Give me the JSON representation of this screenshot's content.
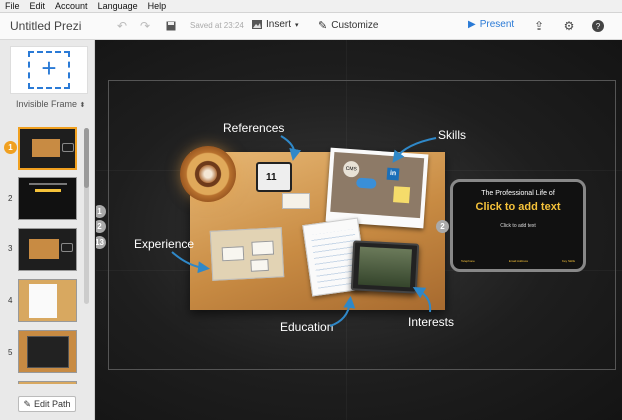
{
  "menu": [
    "File",
    "Edit",
    "Account",
    "Language",
    "Help"
  ],
  "toolbar": {
    "title": "Untitled Prezi",
    "saved": "Saved at 23:24",
    "insert": "Insert",
    "customize": "Customize",
    "present": "Present"
  },
  "sidebar": {
    "frame_type": "Invisible Frame",
    "thumbs": [
      "1",
      "2",
      "3",
      "4",
      "5"
    ],
    "edit_path": "Edit Path"
  },
  "canvas": {
    "labels": {
      "references": "References",
      "skills": "Skills",
      "experience": "Experience",
      "education": "Education",
      "interests": "Interests"
    },
    "slide": {
      "subtitle": "The Professional Life of",
      "title": "Click to add text",
      "body": "Click to add text",
      "footer": [
        "Telephone",
        "Email Address",
        "Key Skills"
      ]
    },
    "badges": [
      "1",
      "2",
      "13",
      "2"
    ]
  }
}
